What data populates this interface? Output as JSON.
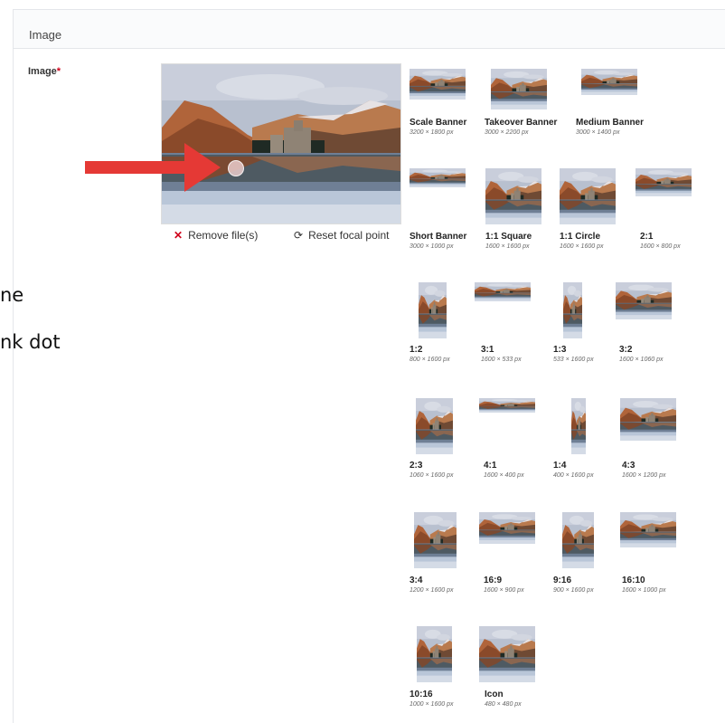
{
  "panel": {
    "title": "Image"
  },
  "field": {
    "label": "Image",
    "required_mark": "*"
  },
  "actions": {
    "remove_label": "Remove file(s)",
    "reset_label": "Reset focal point"
  },
  "overlay_text": {
    "line1": "ne",
    "line2": "nk dot"
  },
  "annotation": {
    "arrow_color": "#e53935"
  },
  "crops": [
    {
      "name": "Scale Banner",
      "dims": "3200 × 1800 px"
    },
    {
      "name": "Takeover Banner",
      "dims": "3000 × 2200 px"
    },
    {
      "name": "Medium Banner",
      "dims": "3000 × 1400 px"
    },
    {
      "name": "Short Banner",
      "dims": "3000 × 1000 px"
    },
    {
      "name": "1:1 Square",
      "dims": "1600 × 1600 px"
    },
    {
      "name": "1:1 Circle",
      "dims": "1600 × 1600 px"
    },
    {
      "name": "2:1",
      "dims": "1600 × 800 px"
    },
    {
      "name": "1:2",
      "dims": "800 × 1600 px"
    },
    {
      "name": "3:1",
      "dims": "1600 × 533 px"
    },
    {
      "name": "1:3",
      "dims": "533 × 1600 px"
    },
    {
      "name": "3:2",
      "dims": "1600 × 1060 px"
    },
    {
      "name": "2:3",
      "dims": "1060 × 1600 px"
    },
    {
      "name": "4:1",
      "dims": "1600 × 400 px"
    },
    {
      "name": "1:4",
      "dims": "400 × 1600 px"
    },
    {
      "name": "4:3",
      "dims": "1600 × 1200 px"
    },
    {
      "name": "3:4",
      "dims": "1200 × 1600 px"
    },
    {
      "name": "16:9",
      "dims": "1600 × 900 px"
    },
    {
      "name": "9:16",
      "dims": "900 × 1600 px"
    },
    {
      "name": "16:10",
      "dims": "1600 × 1000 px"
    },
    {
      "name": "10:16",
      "dims": "1000 × 1600 px"
    },
    {
      "name": "Icon",
      "dims": "480 × 480 px"
    }
  ]
}
